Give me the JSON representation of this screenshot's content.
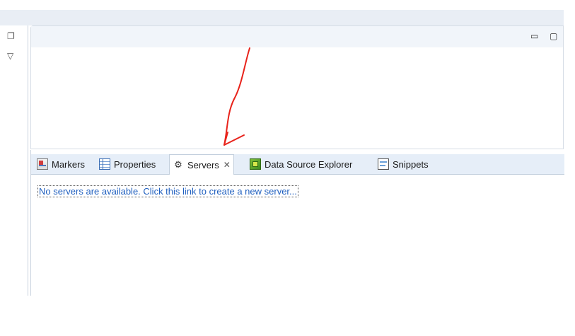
{
  "left_stub": {
    "restore_glyph": "❐",
    "menu_glyph": "▽"
  },
  "upper_view": {
    "minimize_glyph": "▭",
    "maximize_glyph": "▢"
  },
  "tabs": [
    {
      "label": "Markers",
      "icon": "markers-icon"
    },
    {
      "label": "Properties",
      "icon": "properties-icon"
    },
    {
      "label": "Servers",
      "icon": "servers-icon",
      "active": true,
      "close": "✕"
    },
    {
      "label": "Data Source Explorer",
      "icon": "data-source-explorer-icon"
    },
    {
      "label": "Snippets",
      "icon": "snippets-icon"
    }
  ],
  "servers_view": {
    "link_text": "No servers are available. Click this link to create a new server..."
  },
  "colors": {
    "annotation_arrow": "#e8231b",
    "link": "#1f5fbf",
    "tabbar": "#e6eef8"
  }
}
